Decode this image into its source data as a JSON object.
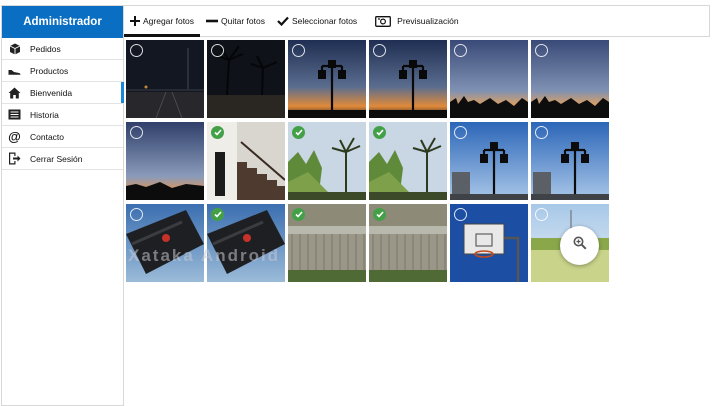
{
  "sidebar": {
    "title": "Administrador",
    "items": [
      {
        "label": "Pedidos",
        "icon": "box-icon"
      },
      {
        "label": "Productos",
        "icon": "shoe-icon"
      },
      {
        "label": "Bienvenida",
        "icon": "home-icon"
      },
      {
        "label": "Historia",
        "icon": "list-icon"
      },
      {
        "label": "Contacto",
        "icon": "at-icon"
      },
      {
        "label": "Cerrar Sesión",
        "icon": "logout-icon"
      }
    ],
    "active_item": "Bienvenida"
  },
  "toolbar": {
    "add_label": "Agregar fotos",
    "remove_label": "Quitar fotos",
    "select_label": "Seleccionar fotos",
    "preview_label": "Previsualización"
  },
  "photos": [
    {
      "scene": "night-road",
      "selected": false
    },
    {
      "scene": "night-palms",
      "selected": false
    },
    {
      "scene": "lamp-dusk",
      "selected": false
    },
    {
      "scene": "lamp-dusk",
      "selected": false
    },
    {
      "scene": "dusk-sky",
      "selected": false
    },
    {
      "scene": "dusk-sky",
      "selected": false
    },
    {
      "scene": "dusk-horizon",
      "selected": false
    },
    {
      "scene": "stairs",
      "selected": true
    },
    {
      "scene": "palm-green",
      "selected": true
    },
    {
      "scene": "palm-green",
      "selected": true
    },
    {
      "scene": "lamp-day",
      "selected": false
    },
    {
      "scene": "lamp-day",
      "selected": false
    },
    {
      "scene": "sign",
      "selected": false
    },
    {
      "scene": "sign",
      "selected": true
    },
    {
      "scene": "fence",
      "selected": true
    },
    {
      "scene": "fence",
      "selected": true
    },
    {
      "scene": "hoop",
      "selected": false
    },
    {
      "scene": "meadow",
      "selected": false
    }
  ],
  "watermark": "Xataka Android",
  "colors": {
    "brand": "#0a6fc2",
    "active_bar": "#1e88d8",
    "selected_check": "#43a047"
  },
  "zoom_icon": "zoom-in-icon"
}
